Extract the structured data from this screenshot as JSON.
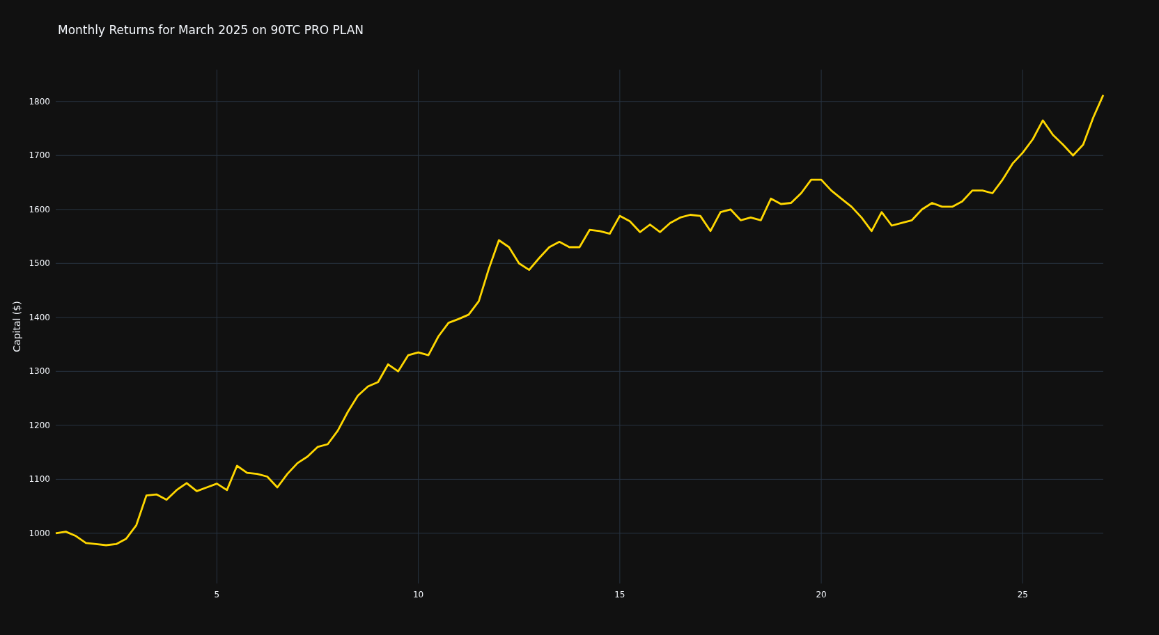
{
  "chart": {
    "chart_data": {
      "type": "line",
      "title": "Monthly Returns for March 2025 on 90TC PRO PLAN",
      "ylabel": "Capital ($)",
      "x": [
        1,
        1.25,
        1.5,
        1.75,
        2,
        2.25,
        2.5,
        2.75,
        3,
        3.25,
        3.5,
        3.75,
        4,
        4.25,
        4.5,
        4.75,
        5,
        5.25,
        5.5,
        5.75,
        6,
        6.25,
        6.5,
        6.75,
        7,
        7.25,
        7.5,
        7.75,
        8,
        8.25,
        8.5,
        8.75,
        9,
        9.25,
        9.5,
        9.75,
        10,
        10.25,
        10.5,
        10.75,
        11,
        11.25,
        11.5,
        11.75,
        12,
        12.25,
        12.5,
        12.75,
        13,
        13.25,
        13.5,
        13.75,
        14,
        14.25,
        14.5,
        14.75,
        15,
        15.25,
        15.5,
        15.75,
        16,
        16.25,
        16.5,
        16.75,
        17,
        17.25,
        17.5,
        17.75,
        18,
        18.25,
        18.5,
        18.75,
        19,
        19.25,
        19.5,
        19.75,
        20,
        20.25,
        20.5,
        20.75,
        21,
        21.25,
        21.5,
        21.75,
        22,
        22.25,
        22.5,
        22.75,
        23,
        23.25,
        23.5,
        23.75,
        24,
        24.25,
        24.5,
        24.75,
        25,
        25.25,
        25.5,
        25.75,
        26,
        26.25,
        26.5,
        26.75,
        27
      ],
      "series": [
        {
          "color": "#ffd700",
          "values": [
            1000,
            1003,
            995,
            982,
            980,
            978,
            980,
            990,
            1015,
            1070,
            1072,
            1062,
            1080,
            1093,
            1078,
            1085,
            1092,
            1080,
            1125,
            1112,
            1110,
            1105,
            1085,
            1110,
            1130,
            1142,
            1160,
            1165,
            1190,
            1225,
            1255,
            1272,
            1280,
            1313,
            1300,
            1330,
            1335,
            1330,
            1365,
            1390,
            1397,
            1405,
            1430,
            1490,
            1543,
            1530,
            1500,
            1488,
            1510,
            1530,
            1540,
            1530,
            1530,
            1562,
            1560,
            1555,
            1588,
            1578,
            1558,
            1572,
            1558,
            1575,
            1585,
            1590,
            1588,
            1560,
            1595,
            1600,
            1580,
            1585,
            1580,
            1620,
            1610,
            1612,
            1630,
            1655,
            1655,
            1635,
            1620,
            1605,
            1585,
            1560,
            1595,
            1570,
            1575,
            1580,
            1600,
            1612,
            1605,
            1605,
            1615,
            1635,
            1635,
            1630,
            1655,
            1685,
            1705,
            1730,
            1765,
            1738,
            1720,
            1700,
            1720,
            1770,
            1812
          ]
        }
      ],
      "xlim": [
        1,
        27
      ],
      "ylim": [
        907,
        1859
      ],
      "xticks": [
        5,
        10,
        15,
        20,
        25
      ],
      "yticks": [
        1000,
        1100,
        1200,
        1300,
        1400,
        1500,
        1600,
        1700,
        1800
      ],
      "grid": true
    }
  }
}
